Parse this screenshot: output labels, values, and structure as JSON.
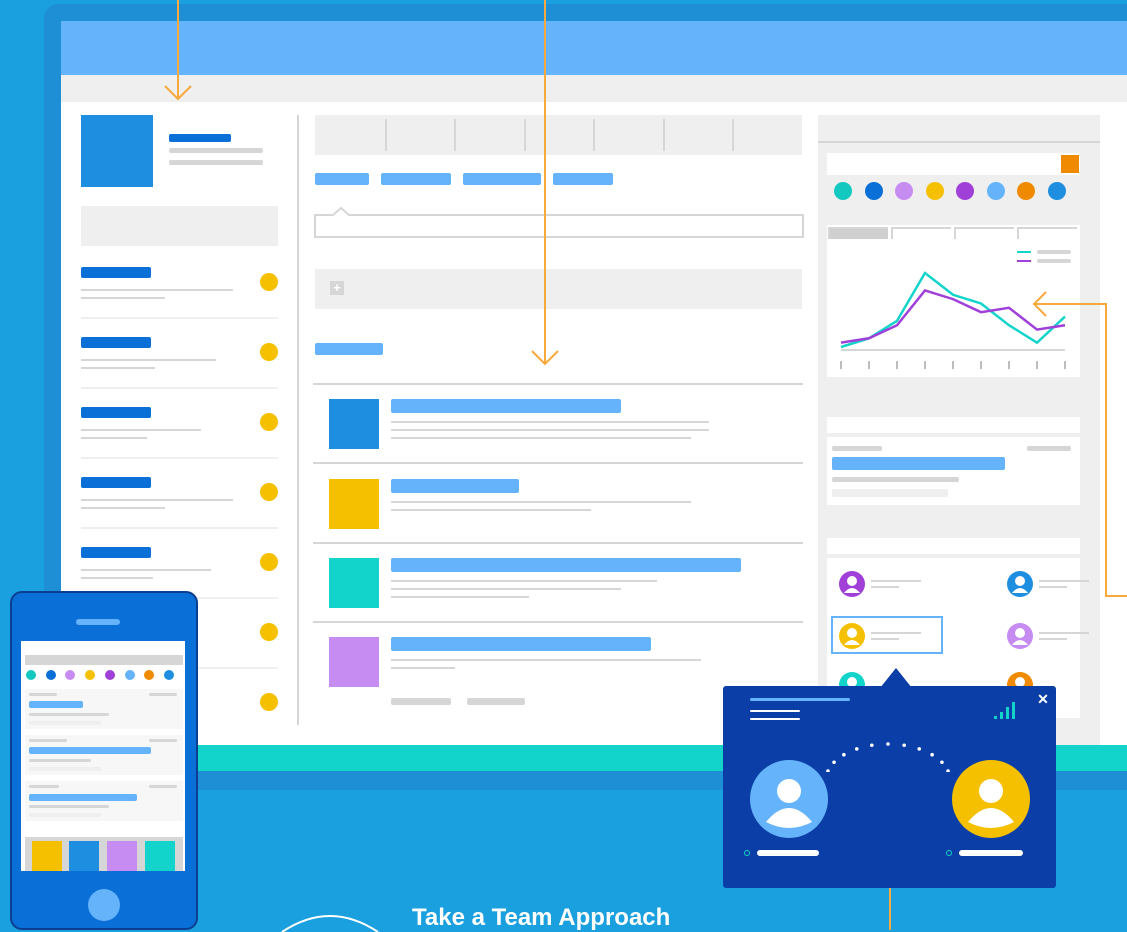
{
  "page": {
    "background": "#1aa0de",
    "cta_title": "Take a Team Approach"
  },
  "colors": {
    "accent_blue": "#65b4fb",
    "dark_blue": "#0a6fd6",
    "teal": "#13d4cb",
    "yellow": "#f5c000",
    "purple": "#c78cf2",
    "orange": "#f08a00",
    "popup_bg": "#0b3ea6"
  },
  "palette": [
    "#13c9bf",
    "#0a6fd6",
    "#c78cf2",
    "#f5c000",
    "#a040d8",
    "#65b4fb",
    "#f08a00",
    "#1e8fe0"
  ],
  "chart_data": {
    "type": "line",
    "series": [
      {
        "color": "#13d4cb",
        "values": [
          0,
          2,
          6,
          17,
          12,
          10,
          5,
          1,
          7
        ]
      },
      {
        "color": "#a040d8",
        "values": [
          1,
          2,
          5,
          13,
          11,
          8,
          9,
          4,
          5
        ]
      }
    ]
  },
  "popup": {
    "close_icon": "close-icon",
    "signal_icon": "signal-icon",
    "caller_left": "user-avatar",
    "caller_right": "user-avatar"
  },
  "icons": {
    "add": "+",
    "close": "✕"
  }
}
